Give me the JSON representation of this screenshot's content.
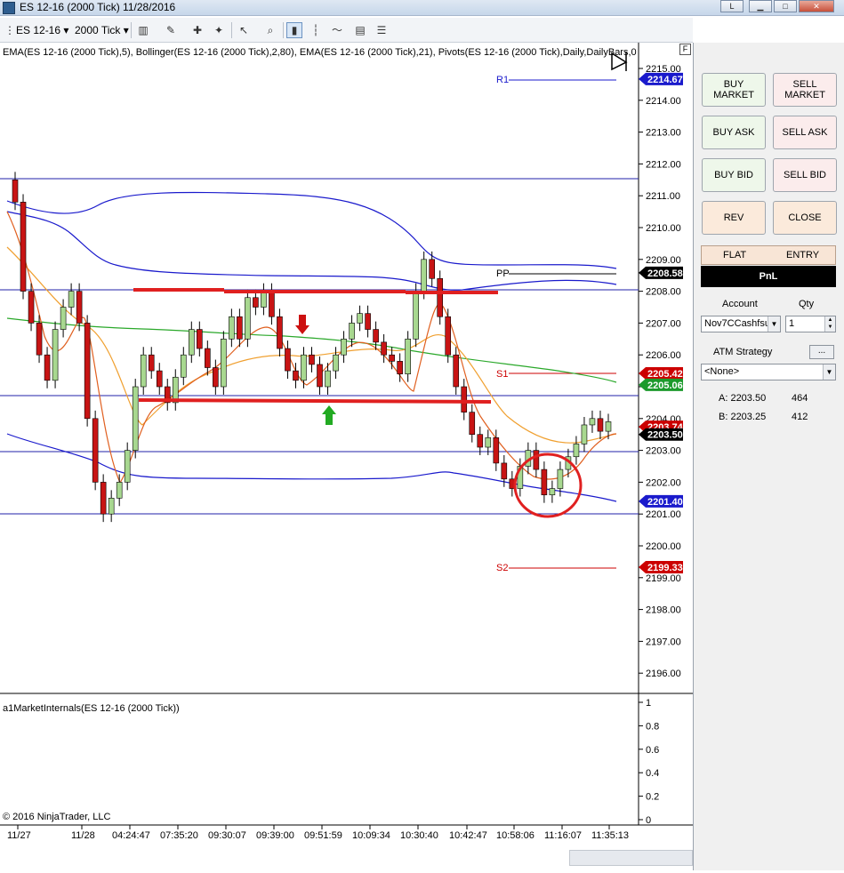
{
  "window": {
    "title": "ES 12-16 (2000 Tick)  11/28/2016",
    "controls": {
      "help": "L",
      "minimize": "▁",
      "maximize": "□",
      "close": "✕"
    }
  },
  "toolbar": {
    "instrument": "ES 12-16",
    "interval": "2000 Tick",
    "dropdown_arrow": "▾"
  },
  "chart": {
    "indicators_label": "EMA(ES 12-16 (2000 Tick),5), Bollinger(ES 12-16 (2000 Tick),2,80), EMA(ES 12-16 (2000 Tick),21), Pivots(ES 12-16 (2000 Tick),Daily,DailyBars,0",
    "panel_button": "F",
    "subpanel_label": "a1MarketInternals(ES 12-16 (2000 Tick))",
    "copyright": "© 2016 NinjaTrader, LLC",
    "price_ticks": [
      "2215.00",
      "2214.00",
      "2213.00",
      "2212.00",
      "2211.00",
      "2210.00",
      "2209.00",
      "2208.00",
      "2207.00",
      "2206.00",
      "2205.00",
      "2204.00",
      "2203.00",
      "2202.00",
      "2201.00",
      "2200.00",
      "2199.00",
      "2198.00",
      "2197.00",
      "2196.00"
    ],
    "sub_ticks": [
      "1",
      "0.8",
      "0.6",
      "0.4",
      "0.2",
      "0"
    ],
    "time_ticks": [
      "11/27",
      "11/28",
      "04:24:47",
      "07:35:20",
      "09:30:07",
      "09:39:00",
      "09:51:59",
      "10:09:34",
      "10:30:40",
      "10:42:47",
      "10:58:06",
      "11:16:07",
      "11:35:13"
    ],
    "pivots": [
      {
        "label": "R1",
        "value": "2214.67",
        "color": "#1a1acc"
      },
      {
        "label": "PP",
        "value": "2208.58",
        "color": "#000000"
      },
      {
        "label": "S1",
        "value": "2205.42",
        "color": "#cc0000"
      },
      {
        "label": "S2",
        "value": "2199.33",
        "color": "#cc0000"
      }
    ],
    "price_markers": [
      {
        "value": "2214.67",
        "bg": "#1a1acc",
        "fg": "#ffffff"
      },
      {
        "value": "2208.58",
        "bg": "#000000",
        "fg": "#ffffff"
      },
      {
        "value": "2205.42",
        "bg": "#cc0000",
        "fg": "#ffffff"
      },
      {
        "value": "2205.06",
        "bg": "#1c9a2c",
        "fg": "#ffffff"
      },
      {
        "value": "2203.74",
        "bg": "#cc0000",
        "fg": "#ffffff"
      },
      {
        "value": "2203.50",
        "bg": "#000000",
        "fg": "#ffffff"
      },
      {
        "value": "2201.40",
        "bg": "#1a1acc",
        "fg": "#ffffff"
      },
      {
        "value": "2199.33",
        "bg": "#cc0000",
        "fg": "#ffffff"
      }
    ],
    "colors": {
      "bollinger": "#1a1acc",
      "ema5": "#e06020",
      "ema21": "#f0a030",
      "ema_slow": "#2aa82a",
      "bull_candle": "#a8d890",
      "bear_candle": "#c81414",
      "annotation": "#e02020"
    }
  },
  "sidepanel": {
    "buttons": {
      "buy_market": "BUY\nMARKET",
      "sell_market": "SELL\nMARKET",
      "buy_ask": "BUY ASK",
      "sell_ask": "SELL ASK",
      "buy_bid": "BUY BID",
      "sell_bid": "SELL BID",
      "rev": "REV",
      "close": "CLOSE"
    },
    "flat": "FLAT",
    "entry": "ENTRY",
    "pnl": "PnL",
    "account_label": "Account",
    "qty_label": "Qty",
    "account_value": "Nov7CCashfsu",
    "qty_value": "1",
    "atm_label": "ATM Strategy",
    "atm_button": "...",
    "atm_value": "<None>",
    "ask_label": "A: 2203.50",
    "ask_size": "464",
    "bid_label": "B: 2203.25",
    "bid_size": "412"
  }
}
